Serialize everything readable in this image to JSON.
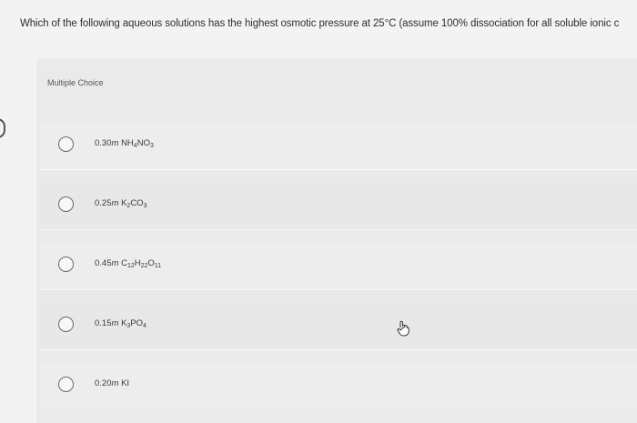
{
  "question": {
    "text": "Which of the following aqueous solutions has the highest osmotic pressure at 25°C (assume 100% dissociation for all soluble ionic c"
  },
  "multiple_choice": {
    "label": "Multiple Choice",
    "options": [
      {
        "amount": "0.30",
        "unit": "m",
        "formula": "NH4NO3"
      },
      {
        "amount": "0.25",
        "unit": "m",
        "formula": "K2CO3"
      },
      {
        "amount": "0.45",
        "unit": "m",
        "formula": "C12H22O11"
      },
      {
        "amount": "0.15",
        "unit": "m",
        "formula": "K3PO4"
      },
      {
        "amount": "0.20",
        "unit": "m",
        "formula": "KI"
      }
    ]
  },
  "icons": {
    "cursor": "hand-pointer-icon",
    "radio": "radio-unselected-icon"
  }
}
